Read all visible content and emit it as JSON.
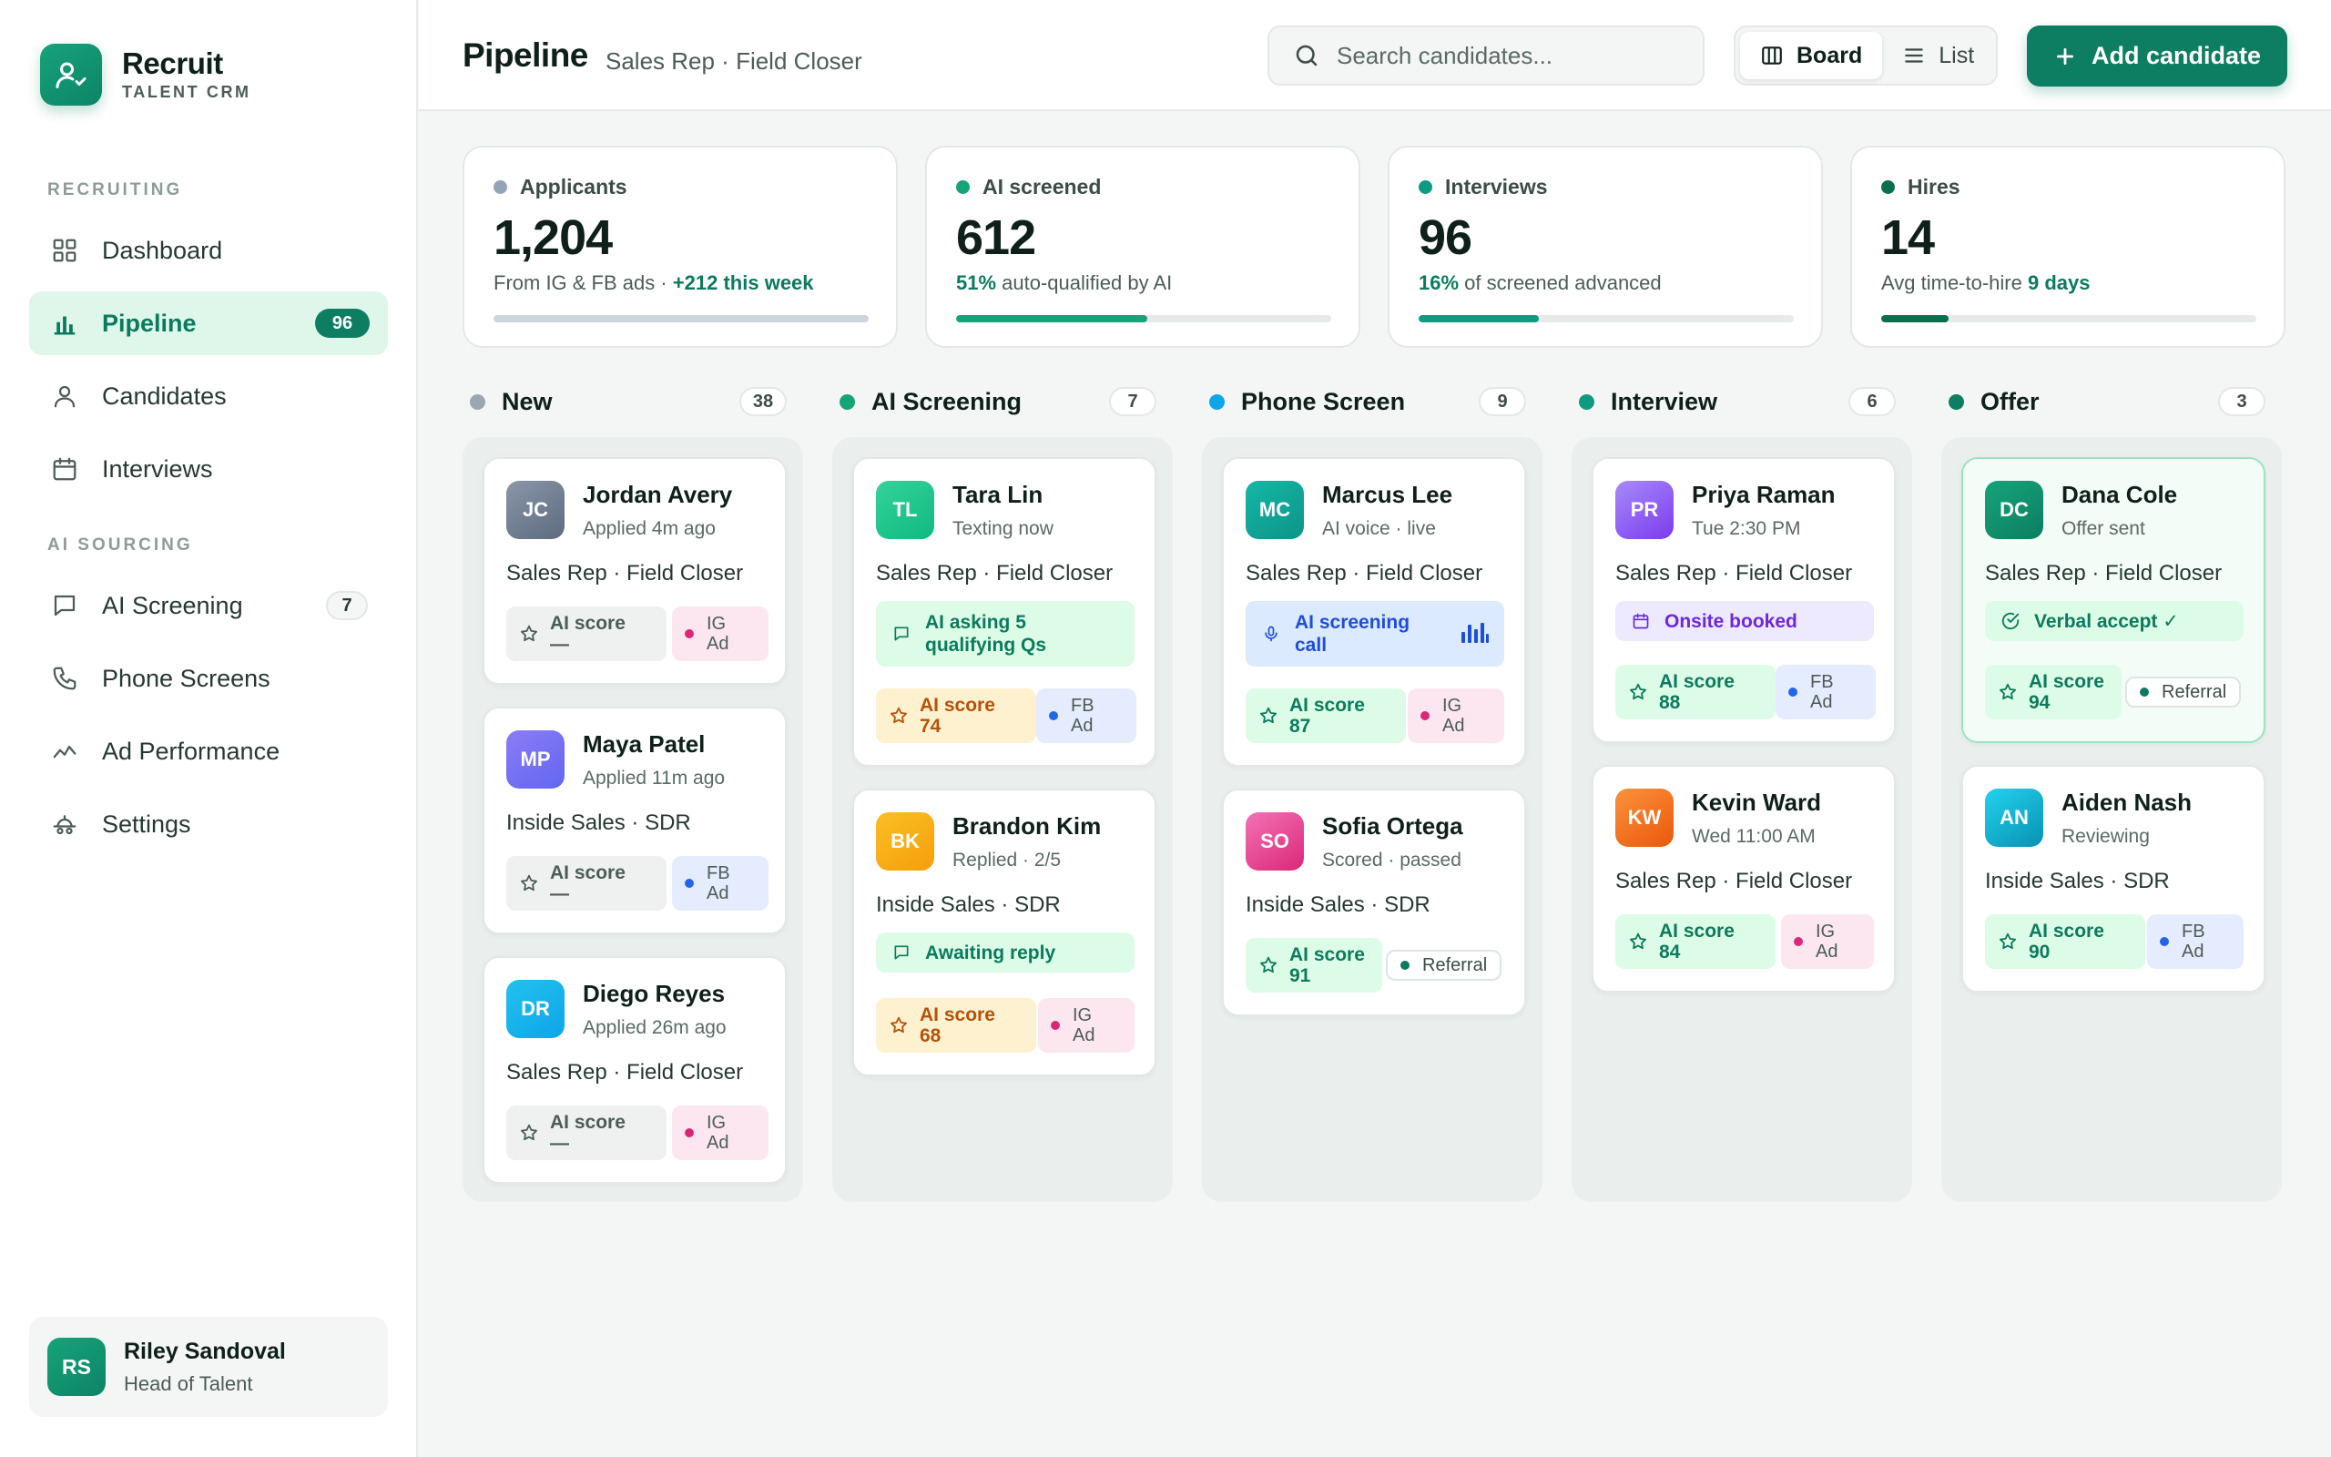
{
  "app": {
    "name": "Recruit",
    "subtitle": "TALENT CRM"
  },
  "sidebar": {
    "sections": [
      "RECRUITING",
      "AI SOURCING"
    ],
    "items": [
      {
        "label": "Dashboard",
        "icon": "dashboard-grid-icon"
      },
      {
        "label": "Pipeline",
        "icon": "bar-chart-icon",
        "badge": "96",
        "active": true
      },
      {
        "label": "Candidates",
        "icon": "person-icon"
      },
      {
        "label": "Interviews",
        "icon": "calendar-icon"
      },
      {
        "label": "AI Screening",
        "icon": "chat-bubble-icon",
        "badge": "7"
      },
      {
        "label": "Phone Screens",
        "icon": "phone-icon"
      },
      {
        "label": "Ad Performance",
        "icon": "trend-line-icon"
      },
      {
        "label": "Settings",
        "icon": "settings-icon"
      }
    ],
    "user": {
      "initials": "RS",
      "name": "Riley Sandoval",
      "role": "Head of Talent"
    }
  },
  "header": {
    "title": "Pipeline",
    "subtitle": "Sales Rep · Field Closer",
    "search_placeholder": "Search candidates...",
    "view_board": "Board",
    "view_list": "List",
    "add_label": "Add candidate"
  },
  "stats": [
    {
      "label": "Applicants",
      "value": "1,204",
      "note_before": "From IG & FB ads · ",
      "note_bold": "+212 this week",
      "note_after": "",
      "progress": 1.0,
      "color": "#94a3b8"
    },
    {
      "label": "AI screened",
      "value": "612",
      "note_before": "",
      "note_bold": "51%",
      "note_after": " auto-qualified by AI",
      "progress": 0.51,
      "color": "#16a37a"
    },
    {
      "label": "Interviews",
      "value": "96",
      "note_before": "",
      "note_bold": "16%",
      "note_after": " of screened advanced",
      "progress": 0.32,
      "color": "#0f9b82"
    },
    {
      "label": "Hires",
      "value": "14",
      "note_before": "Avg time-to-hire ",
      "note_bold": "9 days",
      "note_after": "",
      "progress": 0.18,
      "color": "#0d6e4f"
    }
  ],
  "columns": [
    {
      "title": "New",
      "count": "38",
      "color": "#9aa6b2"
    },
    {
      "title": "AI Screening",
      "count": "7",
      "color": "#16a37a"
    },
    {
      "title": "Phone Screen",
      "count": "9",
      "color": "#0ea5e9"
    },
    {
      "title": "Interview",
      "count": "6",
      "color": "#0f9b82"
    },
    {
      "title": "Offer",
      "count": "3",
      "color": "#0d7e61"
    }
  ],
  "cards": [
    [
      {
        "initials": "JC",
        "name": "Jordan Avery",
        "meta": "Applied 4m ago",
        "role": "Sales Rep · Field Closer",
        "score_label": "AI score",
        "score": "—",
        "tag": "IG Ad"
      },
      {
        "initials": "MP",
        "name": "Maya Patel",
        "meta": "Applied 11m ago",
        "role": "Inside Sales · SDR",
        "score_label": "AI score",
        "score": "—",
        "tag": "FB Ad"
      },
      {
        "initials": "DR",
        "name": "Diego Reyes",
        "meta": "Applied 26m ago",
        "role": "Sales Rep · Field Closer",
        "score_label": "AI score",
        "score": "—",
        "tag": "IG Ad"
      }
    ],
    [
      {
        "initials": "TL",
        "name": "Tara Lin",
        "meta": "Texting now",
        "role": "Sales Rep · Field Closer",
        "status": "AI asking 5 qualifying Qs",
        "score_label": "AI score",
        "score": "74",
        "tag": "FB Ad"
      },
      {
        "initials": "BK",
        "name": "Brandon Kim",
        "meta": "Replied · 2/5",
        "role": "Inside Sales · SDR",
        "status": "Awaiting reply",
        "score_label": "AI score",
        "score": "68",
        "tag": "IG Ad"
      }
    ],
    [
      {
        "initials": "MC",
        "name": "Marcus Lee",
        "meta": "AI voice · live",
        "role": "Sales Rep · Field Closer",
        "status": "AI screening call",
        "score_label": "AI score",
        "score": "87",
        "tag": "IG Ad"
      },
      {
        "initials": "SO",
        "name": "Sofia Ortega",
        "meta": "Scored · passed",
        "role": "Inside Sales · SDR",
        "score_label": "AI score",
        "score": "91",
        "tag": "Referral"
      }
    ],
    [
      {
        "initials": "PR",
        "name": "Priya Raman",
        "meta": "Tue 2:30 PM",
        "role": "Sales Rep · Field Closer",
        "status": "Onsite booked",
        "score_label": "AI score",
        "score": "88",
        "tag": "FB Ad"
      },
      {
        "initials": "KW",
        "name": "Kevin Ward",
        "meta": "Wed 11:00 AM",
        "role": "Sales Rep · Field Closer",
        "score_label": "AI score",
        "score": "84",
        "tag": "IG Ad"
      }
    ],
    [
      {
        "initials": "DC",
        "name": "Dana Cole",
        "meta": "Offer sent",
        "role": "Sales Rep · Field Closer",
        "status": "Verbal accept ✓",
        "score_label": "AI score",
        "score": "94",
        "tag": "Referral"
      },
      {
        "initials": "AN",
        "name": "Aiden Nash",
        "meta": "Reviewing",
        "role": "Inside Sales · SDR",
        "score_label": "AI score",
        "score": "90",
        "tag": "FB Ad"
      }
    ]
  ],
  "colors": {
    "brand": "#0d7e61",
    "ig": "#db2777",
    "fb": "#2563eb",
    "score_green": "#0c7a5e",
    "score_amber": "#b45309"
  }
}
